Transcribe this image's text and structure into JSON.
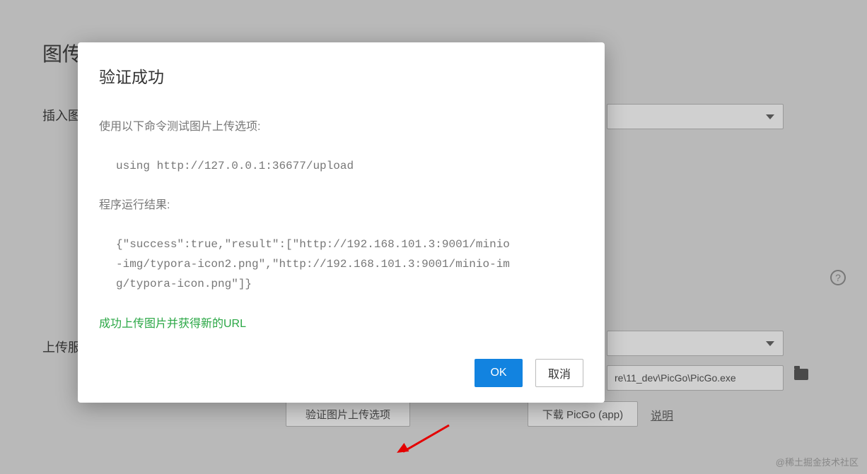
{
  "background": {
    "title": "图传",
    "insert_label": "插入图",
    "upload_label": "上传服",
    "path_value": "re\\11_dev\\PicGo\\PicGo.exe",
    "btn_validate": "验证图片上传选项",
    "btn_download": "下载 PicGo (app)",
    "link_shuoming": "说明",
    "help_glyph": "?"
  },
  "modal": {
    "title": "验证成功",
    "line1": "使用以下命令测试图片上传选项:",
    "code1": "using http://127.0.0.1:36677/upload",
    "line2": "程序运行结果:",
    "code2": "{\"success\":true,\"result\":[\"http://192.168.101.3:9001/minio-img/typora-icon2.png\",\"http://192.168.101.3:9001/minio-img/typora-icon.png\"]}",
    "success_msg": "成功上传图片并获得新的URL",
    "ok_label": "OK",
    "cancel_label": "取消"
  },
  "watermark": "@稀土掘金技术社区"
}
